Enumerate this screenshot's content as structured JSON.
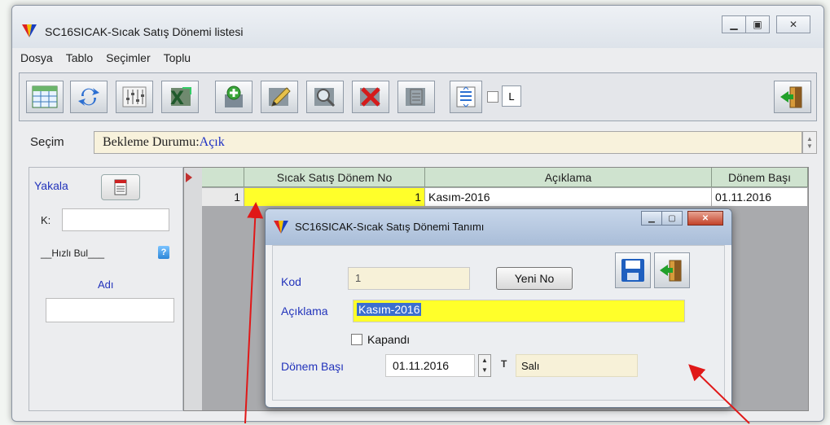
{
  "window": {
    "title": "SC16SICAK-Sıcak Satış Dönemi listesi"
  },
  "menu": [
    "Dosya",
    "Tablo",
    "Seçimler",
    "Toplu"
  ],
  "toolbar": {
    "buttons": [
      "grid-table",
      "refresh",
      "equalizer",
      "excel-export",
      "add-record",
      "edit",
      "search",
      "delete",
      "document",
      "scroll-list",
      "checkbox",
      "l-toggle",
      "exit-door"
    ],
    "l_label": "L"
  },
  "selection": {
    "label": "Seçim",
    "text_prefix": "Bekleme Durumu:",
    "text_value": "Açık"
  },
  "left_panel": {
    "yakala": "Yakala",
    "k_label": "K:",
    "hizli_bul": "__Hızlı Bul___",
    "adi": "Adı"
  },
  "grid": {
    "columns": [
      "Sıcak Satış Dönem No",
      "Açıklama",
      "Dönem Başı"
    ],
    "rows": [
      {
        "row_no": "1",
        "donem_no": "1",
        "aciklama": "Kasım-2016",
        "donem_basi": "01.11.2016"
      }
    ]
  },
  "dialog": {
    "title": "SC16SICAK-Sıcak Satış Dönemi Tanımı",
    "kod_label": "Kod",
    "kod_value": "1",
    "yeni_no": "Yeni No",
    "aciklama_label": "Açıklama",
    "aciklama_value": "Kasım-2016",
    "kapandi_label": "Kapandı",
    "donem_basi_label": "Dönem Başı",
    "donem_basi_value": "01.11.2016",
    "t_label": "T",
    "day_value": "Salı"
  },
  "colors": {
    "accent_blue": "#2233bb",
    "highlight_yellow": "#ffff2a",
    "field_cream": "#f7f1d8",
    "header_green": "#cfe3cf",
    "annotation_red": "#e01818"
  }
}
